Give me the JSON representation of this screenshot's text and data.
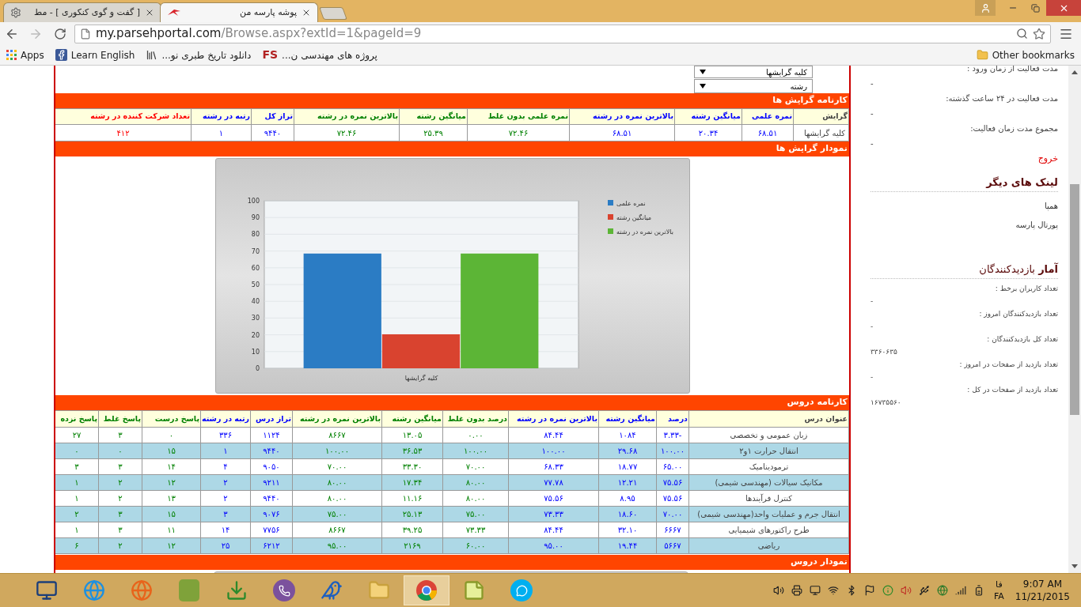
{
  "browser": {
    "tabs": [
      {
        "title": "پوشه پارسه من",
        "selected": true
      },
      {
        "title": "[ گفت و گوی کنکوری ] - مط",
        "selected": false
      }
    ],
    "url": {
      "host": "my.parsehportal.com",
      "path": "/Browse.aspx?extId=1&pageId=9"
    },
    "bookmarks": [
      {
        "kind": "mark",
        "mark": "FS",
        "label": "پروژه های مهندسی ن..."
      },
      {
        "kind": "books",
        "label": "دانلود تاریخ طبری نو..."
      },
      {
        "kind": "social",
        "label": "Learn English"
      },
      {
        "kind": "apps",
        "label": "Apps"
      }
    ],
    "other_bookmarks": "Other bookmarks"
  },
  "filters": [
    {
      "value": "کلیه گرایشها"
    },
    {
      "value": "رشته"
    }
  ],
  "report": {
    "title": "کارنامه گرایش ها",
    "columns": [
      {
        "label": "گرایش",
        "color": "#444444"
      },
      {
        "label": "نمره علمی",
        "color": "#0000ff"
      },
      {
        "label": "میانگین رشته",
        "color": "#0000ff"
      },
      {
        "label": "بالاترین نمره در رشته",
        "color": "#0000ff"
      },
      {
        "label": "نمره علمی بدون غلط",
        "color": "#008000"
      },
      {
        "label": "میانگین رشته",
        "color": "#008000"
      },
      {
        "label": "بالاترین نمره در رشته",
        "color": "#008000"
      },
      {
        "label": "تراز کل",
        "color": "#0000ff"
      },
      {
        "label": "رتبه در رشته",
        "color": "#0000ff"
      },
      {
        "label": "تعداد شرکت کننده در رشته",
        "color": "#ff0000"
      }
    ],
    "rows": [
      [
        "کلیه گرایشها",
        "۶۸.۵۱",
        "۲۰.۳۴",
        "۶۸.۵۱",
        "۷۲.۴۶",
        "۲۵.۳۹",
        "۷۲.۴۶",
        "۹۴۴۰",
        "۱",
        "۴۱۲"
      ]
    ]
  },
  "chart_section": {
    "title": "نمودار گرایش ها",
    "chart_data": {
      "type": "bar",
      "grid": true,
      "legend": true,
      "categories": [
        "کلیه گرایشها"
      ],
      "ylim": [
        0,
        100
      ],
      "yticks": [
        0,
        10,
        20,
        30,
        40,
        50,
        60,
        70,
        80,
        90,
        100
      ],
      "series": [
        {
          "name": "نمره علمی",
          "color": "#2b7cc4",
          "values": [
            68.5
          ]
        },
        {
          "name": "میانگین رشته",
          "color": "#d9432f",
          "values": [
            20.3
          ]
        },
        {
          "name": "بالاترین نمره در رشته",
          "color": "#5cb536",
          "values": [
            68.5
          ]
        }
      ]
    }
  },
  "courses": {
    "title": "کارنامه دروس",
    "columns": [
      {
        "label": "عنوان درس",
        "color": "#444444"
      },
      {
        "label": "درصد",
        "color": "#0000ff"
      },
      {
        "label": "میانگین رشته",
        "color": "#0000ff"
      },
      {
        "label": "بالاترین نمره در رشته",
        "color": "#0000ff"
      },
      {
        "label": "درصد بدون غلط",
        "color": "#008000"
      },
      {
        "label": "میانگین رشته",
        "color": "#008000"
      },
      {
        "label": "بالاترین نمره در رشته",
        "color": "#008000"
      },
      {
        "label": "تراز درس",
        "color": "#0000ff"
      },
      {
        "label": "رتبه در رشته",
        "color": "#0000ff"
      },
      {
        "label": "پاسخ درست",
        "color": "#008000"
      },
      {
        "label": "پاسخ غلط",
        "color": "#008000"
      },
      {
        "label": "پاسخ نزده",
        "color": "#008000"
      }
    ],
    "rows": [
      [
        "زبان عمومی و تخصصی",
        "۳.۳۳-",
        "۱۰۸۴",
        "۸۴.۴۴",
        "۰.۰۰",
        "۱۳.۰۵",
        "۸۶۶۷",
        "۱۱۲۴",
        "۳۳۶",
        "۰",
        "۳",
        "۲۷"
      ],
      [
        "انتقال حرارت ۱و۲",
        "۱۰۰.۰۰",
        "۲۹.۶۸",
        "۱۰۰.۰۰",
        "۱۰۰.۰۰",
        "۳۶.۵۳",
        "۱۰۰.۰۰",
        "۹۴۴۰",
        "۱",
        "۱۵",
        "۰",
        "۰"
      ],
      [
        "ترمودینامیک",
        "۶۵.۰۰",
        "۱۸.۷۷",
        "۶۸.۳۳",
        "۷۰.۰۰",
        "۳۳.۳۰",
        "۷۰.۰۰",
        "۹۰۵۰",
        "۴",
        "۱۴",
        "۳",
        "۳"
      ],
      [
        "مکانیک سیالات (مهندسی شیمی)",
        "۷۵.۵۶",
        "۱۲.۲۱",
        "۷۷.۷۸",
        "۸۰.۰۰",
        "۱۷.۳۴",
        "۸۰.۰۰",
        "۹۲۱۱",
        "۲",
        "۱۲",
        "۲",
        "۱"
      ],
      [
        "کنترل فرآیندها",
        "۷۵.۵۶",
        "۸.۹۵",
        "۷۵.۵۶",
        "۸۰.۰۰",
        "۱۱.۱۶",
        "۸۰.۰۰",
        "۹۴۴۰",
        "۲",
        "۱۳",
        "۲",
        "۱"
      ],
      [
        "انتقال جرم و عملیات واحد(مهندسی شیمی)",
        "۷۰.۰۰",
        "۱۸.۶۰",
        "۷۳.۳۳",
        "۷۵.۰۰",
        "۲۵.۱۳",
        "۷۵.۰۰",
        "۹۰۷۶",
        "۳",
        "۱۵",
        "۳",
        "۲"
      ],
      [
        "طرح راکتورهای شیمیایی",
        "۶۶۶۷",
        "۳۲.۱۰",
        "۸۴.۴۴",
        "۷۳.۳۳",
        "۳۹.۲۵",
        "۸۶۶۷",
        "۷۷۵۶",
        "۱۴",
        "۱۱",
        "۳",
        "۱"
      ],
      [
        "ریاضی",
        "۵۶۶۷",
        "۱۹.۴۴",
        "۹۵.۰۰",
        "۶۰.۰۰",
        "۲۱۶۹",
        "۹۵.۰۰",
        "۶۲۱۲",
        "۲۵",
        "۱۲",
        "۲",
        "۶"
      ]
    ]
  },
  "course_chart_title": "نمودار دروس",
  "sidebar": {
    "activity": [
      {
        "label": "مدت فعالیت از زمان ورود :",
        "value": "-"
      },
      {
        "label": "مدت فعالیت در ۲۴ ساعت گذشته:",
        "value": "-"
      },
      {
        "label": "مجموع مدت زمان فعالیت:",
        "value": "-"
      }
    ],
    "logout": "خروج",
    "links_heading": "لینک های دیگر",
    "links": [
      "همپا",
      "پورتال پارسه"
    ],
    "stats_heading": "**آمار** بازدیدکنندگان",
    "stats": [
      {
        "label": "تعداد کاربران برخط :",
        "value": "-"
      },
      {
        "label": "تعداد بازدیدکنندگان امروز :",
        "value": "-"
      },
      {
        "label": "تعداد کل بازدیدکنندگان :",
        "value": "۳۳۶۰۶۳۵"
      },
      {
        "label": "تعداد بازدید از صفحات در امروز :",
        "value": "-"
      },
      {
        "label": "تعداد بازدید از صفحات در کل :",
        "value": "۱۶۷۳۵۵۶۰"
      }
    ]
  },
  "taskbar": {
    "apps": [
      {
        "selected": false
      },
      {
        "selected": false
      },
      {
        "selected": false
      },
      {
        "selected": false
      },
      {
        "selected": false
      },
      {
        "selected": false
      },
      {
        "selected": false
      },
      {
        "selected": false
      },
      {
        "selected": true
      },
      {
        "selected": false
      },
      {
        "selected": false
      }
    ],
    "language": [
      "فا",
      "FA"
    ],
    "time": "9:07 AM",
    "date": "11/21/2015"
  }
}
